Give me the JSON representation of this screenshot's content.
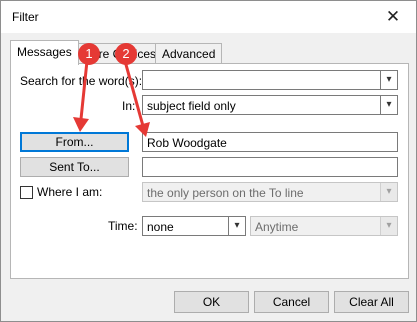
{
  "window": {
    "title": "Filter",
    "close_glyph": "✕"
  },
  "tabs": [
    {
      "label": "Messages",
      "active": true
    },
    {
      "label": "More Choices",
      "active": false
    },
    {
      "label": "Advanced",
      "active": false
    }
  ],
  "messages": {
    "search_label": "Search for the word(s):",
    "search_value": "",
    "in_label": "In:",
    "in_value": "subject field only",
    "from_button": "From...",
    "from_value": "Rob Woodgate",
    "sent_to_button": "Sent To...",
    "sent_to_value": "",
    "where_label": "Where I am:",
    "where_checked": false,
    "where_value": "the only person on the To line",
    "time_label": "Time:",
    "time_value": "none",
    "time_range_value": "Anytime"
  },
  "annotations": [
    {
      "number": "1",
      "color": "#e53935"
    },
    {
      "number": "2",
      "color": "#e53935"
    }
  ],
  "footer": {
    "ok_label": "OK",
    "cancel_label": "Cancel",
    "clear_label": "Clear All"
  },
  "icons": {
    "dropdown": "chevron-down-icon",
    "close": "close-icon"
  }
}
